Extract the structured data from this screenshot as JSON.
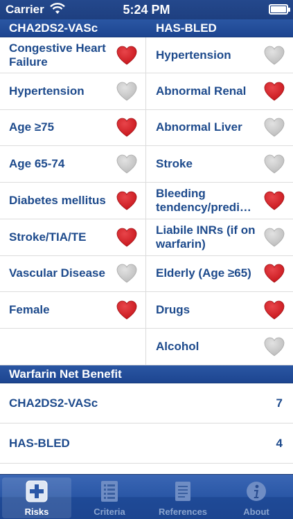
{
  "status_bar": {
    "carrier": "Carrier",
    "time": "5:24 PM"
  },
  "score_header": {
    "left": "CHA2DS2-VASc",
    "right": "HAS-BLED"
  },
  "rows": [
    {
      "left": {
        "label": "Congestive Heart Failure",
        "checked": true
      },
      "right": {
        "label": "Hypertension",
        "checked": false
      }
    },
    {
      "left": {
        "label": "Hypertension",
        "checked": false
      },
      "right": {
        "label": "Abnormal Renal",
        "checked": true
      }
    },
    {
      "left": {
        "label": "Age ≥75",
        "checked": true
      },
      "right": {
        "label": "Abnormal Liver",
        "checked": false
      }
    },
    {
      "left": {
        "label": "Age 65-74",
        "checked": false
      },
      "right": {
        "label": "Stroke",
        "checked": false
      }
    },
    {
      "left": {
        "label": "Diabetes mellitus",
        "checked": true
      },
      "right": {
        "label": "Bleeding tendency/predi…",
        "checked": true
      }
    },
    {
      "left": {
        "label": "Stroke/TIA/TE",
        "checked": true
      },
      "right": {
        "label": "Liabile INRs (if on warfarin)",
        "checked": false
      }
    },
    {
      "left": {
        "label": "Vascular Disease",
        "checked": false
      },
      "right": {
        "label": "Elderly (Age ≥65)",
        "checked": true
      }
    },
    {
      "left": {
        "label": "Female",
        "checked": true
      },
      "right": {
        "label": "Drugs",
        "checked": true
      }
    },
    {
      "left": {
        "label": ""
      },
      "right": {
        "label": "Alcohol",
        "checked": false
      }
    }
  ],
  "warfarin": {
    "header": "Warfarin Net Benefit",
    "scores": [
      {
        "label": "CHA2DS2-VASc",
        "value": "7"
      },
      {
        "label": "HAS-BLED",
        "value": "4"
      }
    ]
  },
  "tabs": [
    {
      "label": "Risks",
      "icon": "plus-icon",
      "active": true
    },
    {
      "label": "Criteria",
      "icon": "list-icon",
      "active": false
    },
    {
      "label": "References",
      "icon": "document-icon",
      "active": false
    },
    {
      "label": "About",
      "icon": "info-icon",
      "active": false
    }
  ],
  "colors": {
    "heart_on": "#c8171d",
    "heart_off": "#bdbdbd",
    "header_bg": "#1d4590",
    "text": "#1d4a8c"
  }
}
